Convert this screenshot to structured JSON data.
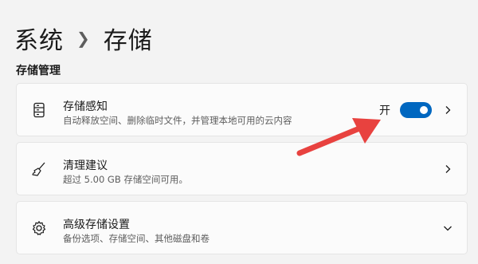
{
  "breadcrumb": {
    "parent": "系统",
    "current": "存储"
  },
  "section": {
    "title": "存储管理"
  },
  "cards": [
    {
      "title": "存储感知",
      "desc": "自动释放空间、删除临时文件，并管理本地可用的云内容",
      "toggle_label": "开",
      "toggle_state": true,
      "icon": "drive-icon",
      "trailing": "chevron-right-icon"
    },
    {
      "title": "清理建议",
      "desc": "超过 5.00 GB 存储空间可用。",
      "icon": "broom-icon",
      "trailing": "chevron-right-icon"
    },
    {
      "title": "高级存储设置",
      "desc": "备份选项、存储空间、其他磁盘和卷",
      "icon": "gear-icon",
      "trailing": "chevron-down-icon"
    }
  ],
  "colors": {
    "accent": "#0067c0",
    "annotation_arrow": "#e8423f",
    "background": "#f3f3f3"
  }
}
